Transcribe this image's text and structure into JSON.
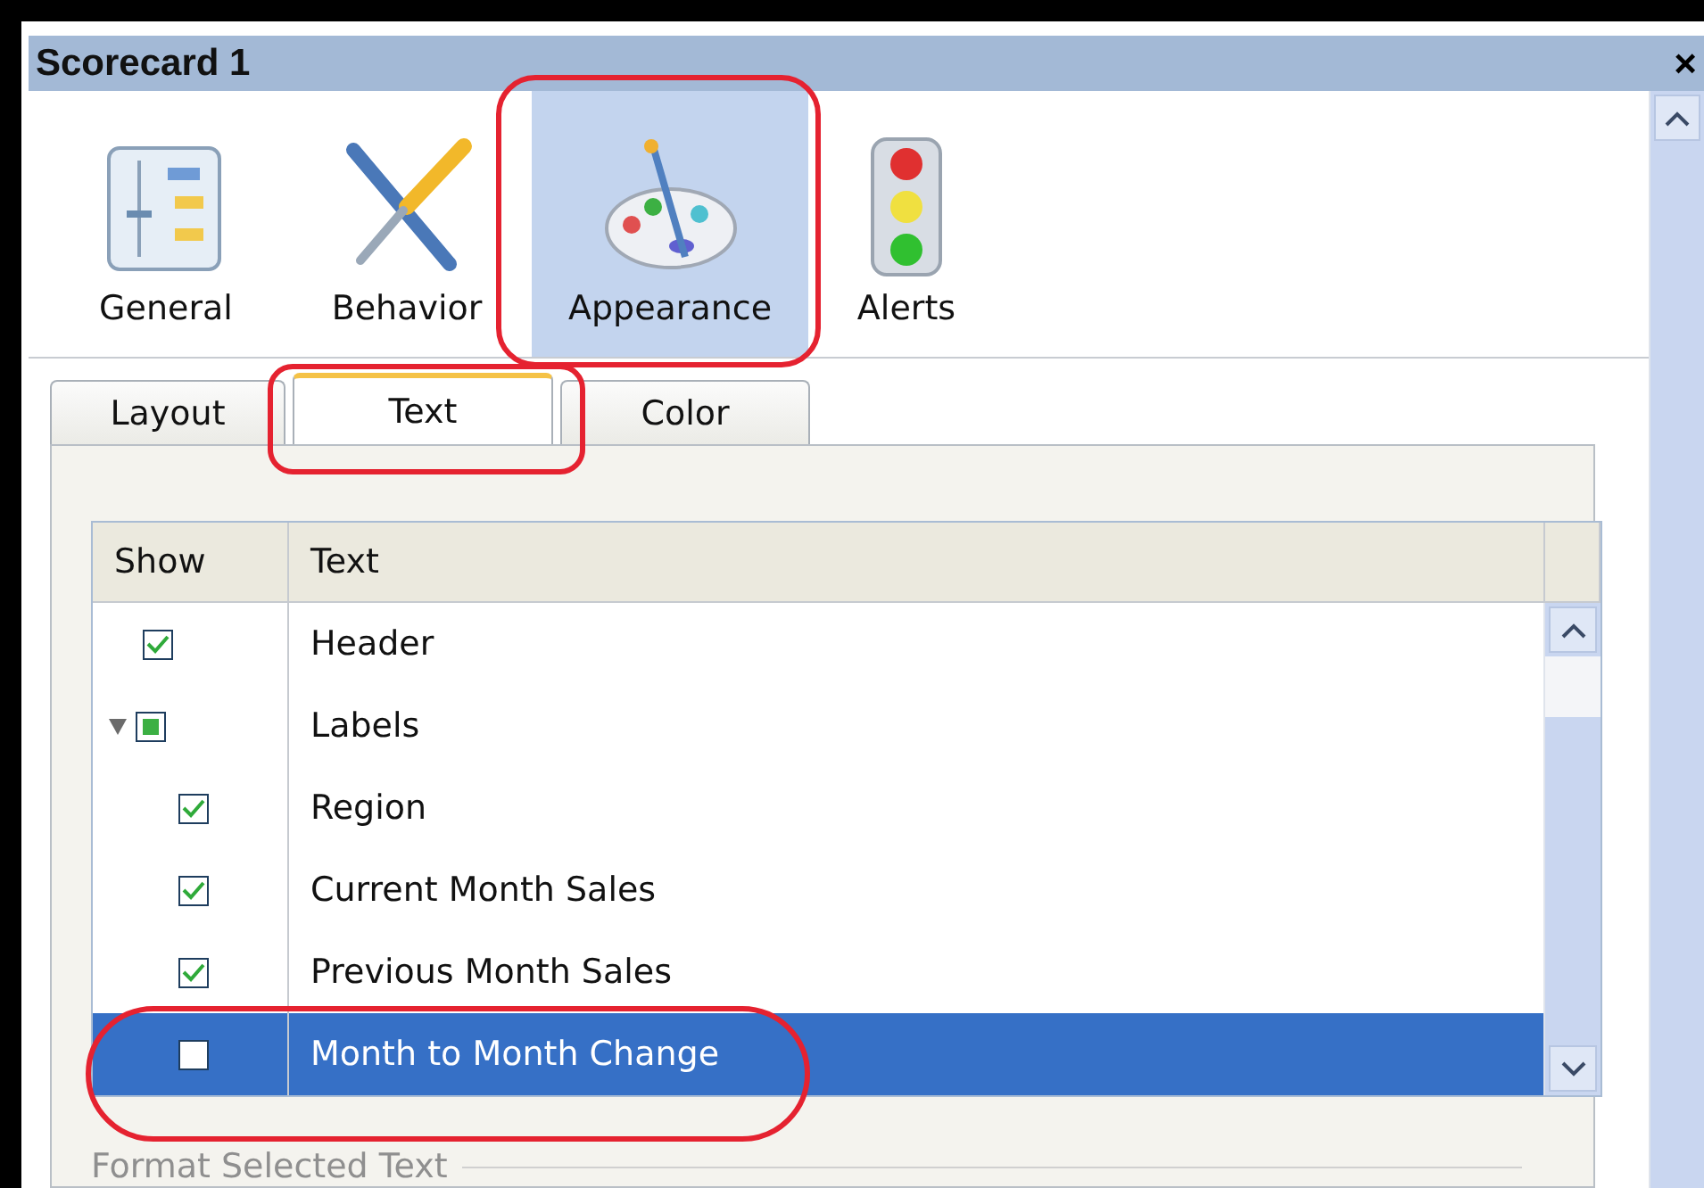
{
  "window": {
    "title": "Scorecard 1",
    "close": "×"
  },
  "categories": [
    {
      "label": "General",
      "selected": false
    },
    {
      "label": "Behavior",
      "selected": false
    },
    {
      "label": "Appearance",
      "selected": true
    },
    {
      "label": "Alerts",
      "selected": false
    }
  ],
  "tabs": [
    {
      "label": "Layout",
      "selected": false
    },
    {
      "label": "Text",
      "selected": true
    },
    {
      "label": "Color",
      "selected": false
    }
  ],
  "grid": {
    "columns": [
      "Show",
      "Text"
    ],
    "rows": [
      {
        "text": "Header",
        "checked": true,
        "mixed": false,
        "selected": false
      },
      {
        "text": "Labels",
        "checked": true,
        "mixed": true,
        "selected": false,
        "expanded": true,
        "children": [
          {
            "text": "Region",
            "checked": true,
            "mixed": false,
            "selected": false
          },
          {
            "text": "Current Month Sales",
            "checked": true,
            "mixed": false,
            "selected": false
          },
          {
            "text": "Previous Month Sales",
            "checked": true,
            "mixed": false,
            "selected": false
          },
          {
            "text": "Month to Month Change",
            "checked": false,
            "mixed": false,
            "selected": true
          }
        ]
      }
    ]
  },
  "format_section": {
    "title": "Format Selected Text"
  }
}
